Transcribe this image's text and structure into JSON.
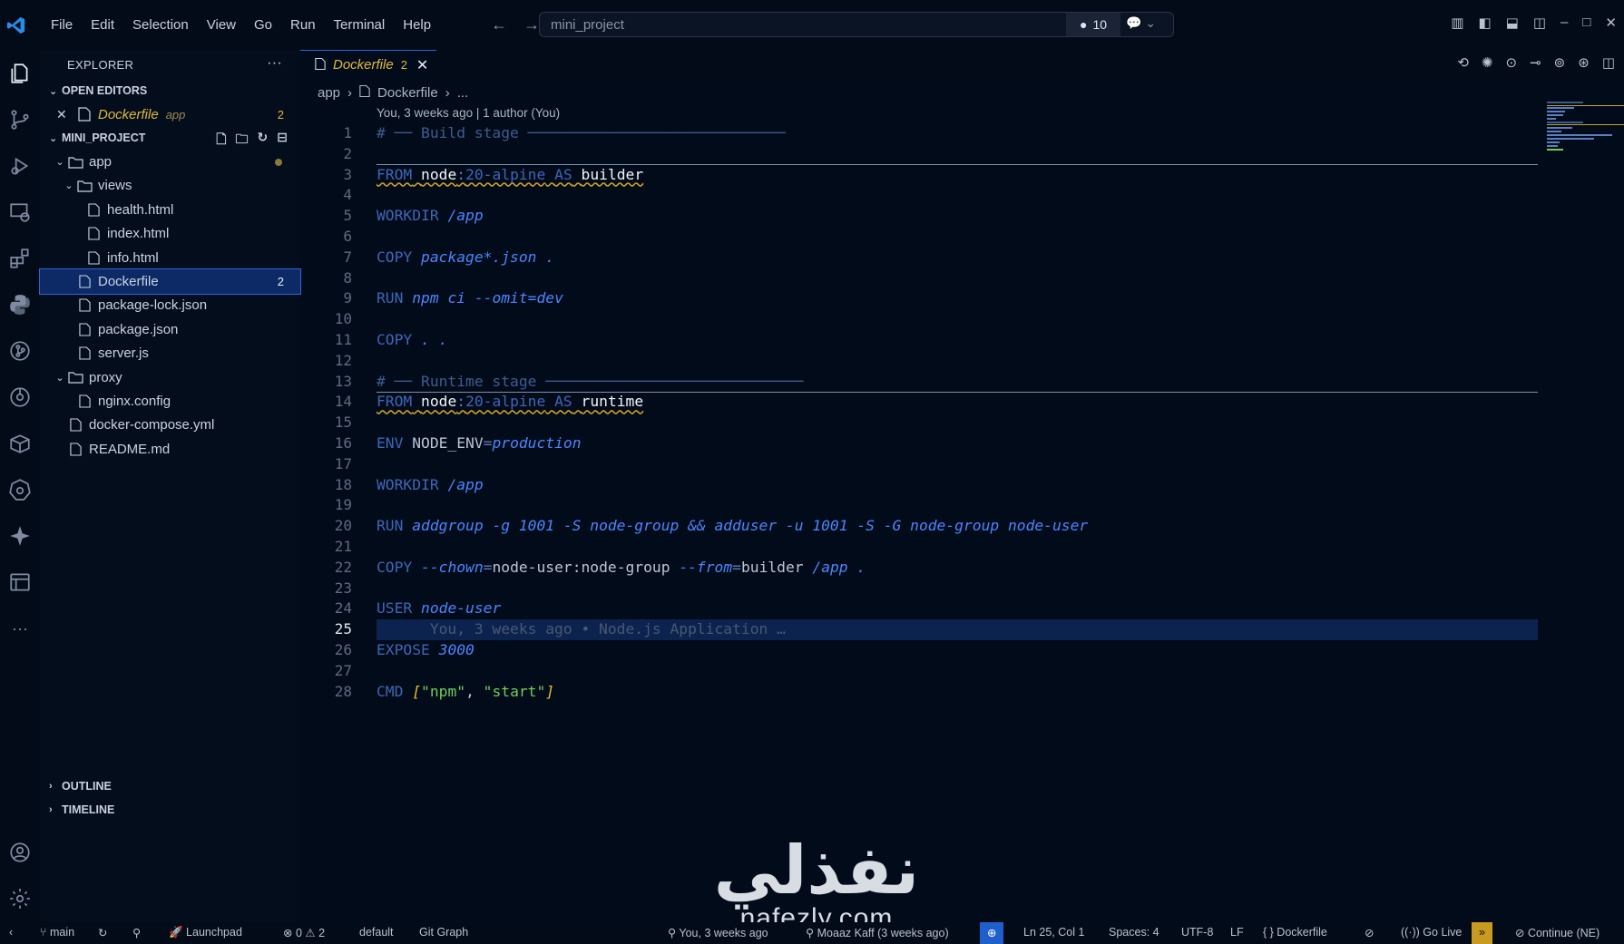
{
  "menu": [
    "File",
    "Edit",
    "Selection",
    "View",
    "Go",
    "Run",
    "Terminal",
    "Help"
  ],
  "command_center": {
    "text": "mini_project",
    "badge_count": "10"
  },
  "sidebar": {
    "title": "EXPLORER",
    "open_editors_label": "OPEN EDITORS",
    "open_editor": {
      "name": "Dockerfile",
      "path": "app",
      "count": "2"
    },
    "project_label": "MINI_PROJECT",
    "tree": [
      {
        "name": "app",
        "type": "folder",
        "depth": 0
      },
      {
        "name": "views",
        "type": "folder",
        "depth": 1
      },
      {
        "name": "health.html",
        "type": "file",
        "depth": 2
      },
      {
        "name": "index.html",
        "type": "file",
        "depth": 2
      },
      {
        "name": "info.html",
        "type": "file",
        "depth": 2
      },
      {
        "name": "Dockerfile",
        "type": "docker",
        "depth": 1,
        "count": "2"
      },
      {
        "name": "package-lock.json",
        "type": "file",
        "depth": 1
      },
      {
        "name": "package.json",
        "type": "file",
        "depth": 1
      },
      {
        "name": "server.js",
        "type": "file",
        "depth": 1
      },
      {
        "name": "proxy",
        "type": "folder",
        "depth": 0
      },
      {
        "name": "nginx.config",
        "type": "file",
        "depth": 1
      },
      {
        "name": "docker-compose.yml",
        "type": "file",
        "depth": 0
      },
      {
        "name": "README.md",
        "type": "file",
        "depth": 0
      }
    ],
    "outline_label": "OUTLINE",
    "timeline_label": "TIMELINE"
  },
  "tab": {
    "name": "Dockerfile",
    "count": "2"
  },
  "breadcrumb": {
    "folder": "app",
    "file": "Dockerfile",
    "more": "..."
  },
  "blame_header": "You, 3 weeks ago | 1 author (You)",
  "current_line": "25",
  "code_lines": [
    {
      "n": "1",
      "tokens": [
        [
          "cm",
          "# ── Build stage ─────────────────────────────"
        ]
      ]
    },
    {
      "n": "2",
      "tokens": []
    },
    {
      "n": "3",
      "tokens": [
        [
          "kw sq",
          "FROM"
        ],
        [
          "pl sq",
          " "
        ],
        [
          "img sq",
          "node"
        ],
        [
          "op sq",
          ":"
        ],
        [
          "kw sq",
          "20-alpine"
        ],
        [
          "pl sq",
          " "
        ],
        [
          "kw sq",
          "AS"
        ],
        [
          "pl sq",
          " "
        ],
        [
          "img sq",
          "builder"
        ]
      ]
    },
    {
      "n": "4",
      "tokens": []
    },
    {
      "n": "5",
      "tokens": [
        [
          "kw",
          "WORKDIR"
        ],
        [
          "pl",
          " "
        ],
        [
          "it",
          "/app"
        ]
      ]
    },
    {
      "n": "6",
      "tokens": []
    },
    {
      "n": "7",
      "tokens": [
        [
          "kw",
          "COPY"
        ],
        [
          "pl",
          " "
        ],
        [
          "it",
          "package*.json ."
        ]
      ]
    },
    {
      "n": "8",
      "tokens": []
    },
    {
      "n": "9",
      "tokens": [
        [
          "kw",
          "RUN"
        ],
        [
          "pl",
          " "
        ],
        [
          "it",
          "npm ci --omit=dev"
        ]
      ]
    },
    {
      "n": "10",
      "tokens": []
    },
    {
      "n": "11",
      "tokens": [
        [
          "kw",
          "COPY"
        ],
        [
          "pl",
          " "
        ],
        [
          "it",
          ". ."
        ]
      ]
    },
    {
      "n": "12",
      "tokens": []
    },
    {
      "n": "13",
      "tokens": [
        [
          "cm",
          "# ── Runtime stage ─────────────────────────────"
        ]
      ]
    },
    {
      "n": "14",
      "tokens": [
        [
          "kw sq",
          "FROM"
        ],
        [
          "pl sq",
          " "
        ],
        [
          "img sq",
          "node"
        ],
        [
          "op sq",
          ":"
        ],
        [
          "kw sq",
          "20-alpine"
        ],
        [
          "pl sq",
          " "
        ],
        [
          "kw sq",
          "AS"
        ],
        [
          "pl sq",
          " "
        ],
        [
          "img sq",
          "runtime"
        ]
      ]
    },
    {
      "n": "15",
      "tokens": []
    },
    {
      "n": "16",
      "tokens": [
        [
          "kw",
          "ENV"
        ],
        [
          "pl",
          " NODE_ENV"
        ],
        [
          "op",
          "="
        ],
        [
          "it",
          "production"
        ]
      ]
    },
    {
      "n": "17",
      "tokens": []
    },
    {
      "n": "18",
      "tokens": [
        [
          "kw",
          "WORKDIR"
        ],
        [
          "pl",
          " "
        ],
        [
          "it",
          "/app"
        ]
      ]
    },
    {
      "n": "19",
      "tokens": []
    },
    {
      "n": "20",
      "tokens": [
        [
          "kw",
          "RUN"
        ],
        [
          "pl",
          " "
        ],
        [
          "it",
          "addgroup -g 1001 -S node-group && adduser -u 1001 -S -G node-group node-user"
        ]
      ]
    },
    {
      "n": "21",
      "tokens": []
    },
    {
      "n": "22",
      "tokens": [
        [
          "kw",
          "COPY"
        ],
        [
          "pl",
          " "
        ],
        [
          "it",
          "--chown"
        ],
        [
          "op",
          "="
        ],
        [
          "pl",
          "node-user:node-group "
        ],
        [
          "it",
          "--from"
        ],
        [
          "op",
          "="
        ],
        [
          "pl",
          "builder "
        ],
        [
          "it",
          "/app ."
        ]
      ]
    },
    {
      "n": "23",
      "tokens": []
    },
    {
      "n": "24",
      "tokens": [
        [
          "kw",
          "USER"
        ],
        [
          "pl",
          " "
        ],
        [
          "it",
          "node-user"
        ]
      ]
    },
    {
      "n": "25",
      "tokens": [
        [
          "ghost",
          "      You, 3 weeks ago • Node.js Application …"
        ]
      ]
    },
    {
      "n": "26",
      "tokens": [
        [
          "kw",
          "EXPOSE"
        ],
        [
          "pl",
          " "
        ],
        [
          "it",
          "3000"
        ]
      ]
    },
    {
      "n": "27",
      "tokens": []
    },
    {
      "n": "28",
      "tokens": [
        [
          "kw",
          "CMD"
        ],
        [
          "pl",
          " "
        ],
        [
          "br",
          "["
        ],
        [
          "str",
          "\"npm\""
        ],
        [
          "pl",
          ", "
        ],
        [
          "str",
          "\"start\""
        ],
        [
          "br",
          "]"
        ]
      ]
    }
  ],
  "watermark": {
    "arabic": "نفذلي",
    "latin": "nafezly.com"
  },
  "status": {
    "branch": "main",
    "launchpad": "Launchpad",
    "errors": "0",
    "warnings": "2",
    "profile": "default",
    "git_graph": "Git Graph",
    "blame": "You, 3 weeks ago",
    "author": "Moaaz Kaff (3 weeks ago)",
    "position": "Ln 25, Col 1",
    "spaces": "Spaces: 4",
    "encoding": "UTF-8",
    "eol": "LF",
    "language": "Dockerfile",
    "golive": "Go Live",
    "continue": "Continue (NE)"
  },
  "colors": {
    "accent": "#2c66d6",
    "warning": "#e0b840",
    "background": "#020b1a"
  }
}
